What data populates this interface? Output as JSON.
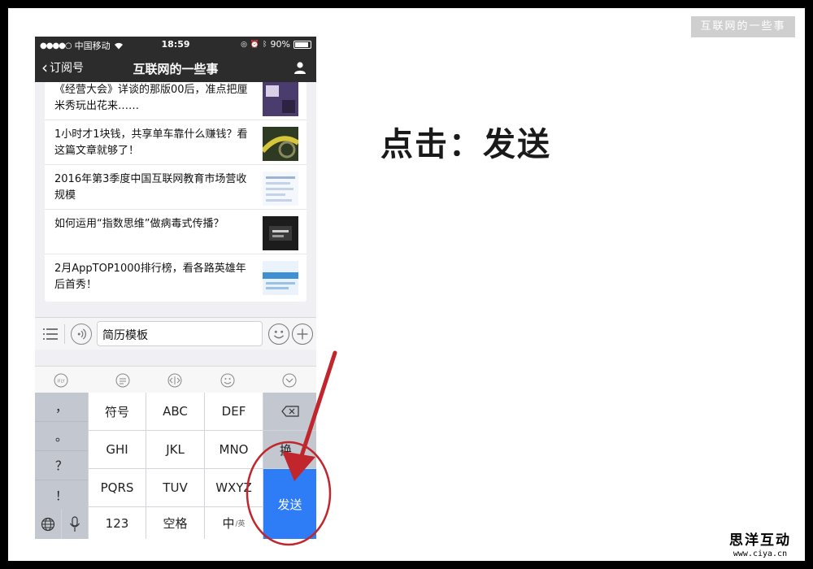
{
  "watermark": "互联网的一些事",
  "instruction": "点击：发送",
  "site_logo": {
    "name": "思洋互动",
    "url": "www.ciya.cn"
  },
  "status_bar": {
    "carrier": "中国移动",
    "time": "18:59",
    "battery": "90%"
  },
  "nav": {
    "back_label": "订阅号",
    "title": "互联网的一些事"
  },
  "articles": [
    {
      "title": "《经营大会》详谈的那版00后，准点把厘米秀玩出花来……"
    },
    {
      "title": "1小时才1块钱，共享单车靠什么赚钱？看这篇文章就够了！"
    },
    {
      "title": "2016年第3季度中国互联网教育市场营收规模"
    },
    {
      "title": "如何运用“指数思维”做病毒式传播？"
    },
    {
      "title": "2月AppTOP1000排行榜，看各路英雄年后首秀！"
    }
  ],
  "input": {
    "value": "简历模板"
  },
  "keyboard": {
    "left_column": [
      "，",
      "。",
      "？",
      "！"
    ],
    "row1": [
      "符号",
      "ABC",
      "DEF"
    ],
    "row2": [
      "GHI",
      "JKL",
      "MNO"
    ],
    "row3": [
      "PQRS",
      "TUV",
      "WXYZ"
    ],
    "row4": [
      "123",
      "空格",
      "中"
    ],
    "lang_sub": "/英",
    "line_break_partial": "换",
    "send": "发送"
  },
  "colors": {
    "nav_bg": "#2c2c2c",
    "send_key": "#2e7cf6",
    "annotation_red": "#c0262b"
  }
}
